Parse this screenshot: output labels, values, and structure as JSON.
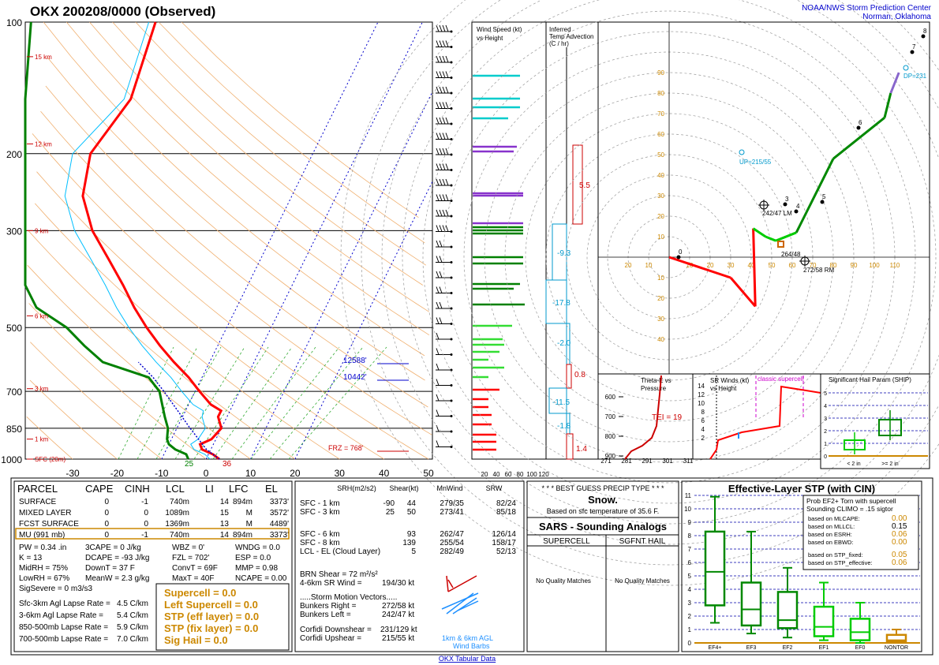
{
  "header": {
    "title": "OKX   200208/0000  (Observed)",
    "center_line1": "NOAA/NWS Storm Prediction Center",
    "center_line2": "Norman, Oklahoma",
    "footer_link": "OKX Tabular Data"
  },
  "colors": {
    "temp": "#ff0000",
    "dewpoint": "#008000",
    "wetbulb": "#00bfff",
    "parcel": "#0000cc",
    "blue_text": "#0000cc",
    "gold": "#cc8800",
    "axis": "#000000"
  },
  "chart_data": [
    {
      "type": "line",
      "name": "skewt",
      "ylabel_ticks": [
        "100",
        "200",
        "300",
        "500",
        "700",
        "850",
        "1000"
      ],
      "xticks": [
        "-30",
        "-20",
        "-10",
        "0",
        "10",
        "20",
        "30",
        "40",
        "50"
      ],
      "height_labels": [
        "15 km",
        "12 km",
        "9 km",
        "6 km",
        "3 km",
        "1 km",
        "SFC (20m)"
      ],
      "temperature_profile": [
        [
          1000,
          3
        ],
        [
          975,
          1
        ],
        [
          950,
          -2
        ],
        [
          925,
          -3
        ],
        [
          900,
          -1
        ],
        [
          850,
          0
        ],
        [
          800,
          -2
        ],
        [
          775,
          -2
        ],
        [
          750,
          -5
        ],
        [
          700,
          -9
        ],
        [
          650,
          -13
        ],
        [
          600,
          -18
        ],
        [
          550,
          -23
        ],
        [
          500,
          -28
        ],
        [
          450,
          -33
        ],
        [
          400,
          -38
        ],
        [
          350,
          -44
        ],
        [
          300,
          -51
        ],
        [
          250,
          -57
        ],
        [
          200,
          -60
        ],
        [
          150,
          -57
        ],
        [
          100,
          -60
        ]
      ],
      "dewpoint_profile": [
        [
          1000,
          -4
        ],
        [
          975,
          -5
        ],
        [
          950,
          -8
        ],
        [
          925,
          -10
        ],
        [
          900,
          -11
        ],
        [
          850,
          -12
        ],
        [
          800,
          -14
        ],
        [
          700,
          -18
        ],
        [
          650,
          -22
        ],
        [
          600,
          -34
        ],
        [
          550,
          -40
        ],
        [
          500,
          -46
        ],
        [
          450,
          -55
        ],
        [
          400,
          -68
        ],
        [
          350,
          -73
        ],
        [
          300,
          -74
        ],
        [
          250,
          -75
        ],
        [
          200,
          -78
        ],
        [
          150,
          -82
        ],
        [
          100,
          -88
        ]
      ],
      "annotations": {
        "lcl_height": "12588'",
        "el_height": "10442'",
        "frz": "FRZ = 768'",
        "sfc_temp": "36",
        "sfc_dew": "25"
      }
    },
    {
      "type": "bar",
      "name": "wind_speed_panel",
      "title": "Wind Speed (kt)",
      "subtitle": "vs Height",
      "xticks": [
        "20",
        "40",
        "60",
        "80",
        "100",
        "120"
      ]
    },
    {
      "type": "bar",
      "name": "inferred_temp_advection",
      "title": "Inferred",
      "subtitle": "Temp Advection",
      "subtitle2": "(C / hr)",
      "labels": [
        "5.5",
        "-9.3",
        "-17.8",
        "-2.0",
        "0.8",
        "-11.5",
        "-1.8",
        "1.4"
      ]
    },
    {
      "type": "line",
      "name": "hodograph",
      "xticks": [
        "20",
        "10",
        "10",
        "20",
        "30",
        "40",
        "50",
        "60",
        "70",
        "80",
        "90",
        "100",
        "110"
      ],
      "yticks": [
        "90",
        "80",
        "70",
        "60",
        "50",
        "40",
        "30",
        "20",
        "10",
        "10",
        "20",
        "30",
        "40"
      ],
      "labels": {
        "up": "UP=215/55",
        "dp": "DP=231",
        "lm": "242/47 LM",
        "rm": "272/58 RM",
        "mean": "264/48"
      },
      "points": [
        [
          0,
          0
        ],
        [
          30,
          -10
        ],
        [
          42,
          -24
        ],
        [
          41,
          14
        ],
        [
          47,
          10
        ],
        [
          52,
          8
        ],
        [
          62,
          12
        ],
        [
          80,
          48
        ],
        [
          105,
          68
        ],
        [
          108,
          80
        ],
        [
          112,
          90
        ]
      ]
    },
    {
      "type": "line",
      "name": "theta_e",
      "title": "Theta-E vs",
      "subtitle": "Pressure",
      "xticks": [
        "271",
        "281",
        "291",
        "301",
        "311"
      ],
      "yticks": [
        "600",
        "700",
        "800",
        "900"
      ],
      "tei": "TEI = 19"
    },
    {
      "type": "line",
      "name": "sr_winds",
      "title": "SR Winds (kt)",
      "subtitle": "vs Height",
      "yticks": [
        "14",
        "12",
        "10",
        "8",
        "6",
        "4",
        "2"
      ],
      "xticks": [
        "0",
        "40",
        "80",
        "120"
      ],
      "label": "classic supercell"
    },
    {
      "type": "bar",
      "name": "ship",
      "title": "Significant Hail Param (SHIP)",
      "yticks": [
        "5",
        "4",
        "3",
        "2",
        "1",
        "0"
      ],
      "categories": [
        "< 2 in",
        ">= 2 in"
      ]
    },
    {
      "type": "bar",
      "name": "effective_stp",
      "title": "Effective-Layer STP (with CIN)",
      "yticks": [
        "11",
        "10",
        "9",
        "8",
        "7",
        "6",
        "5",
        "4",
        "3",
        "2",
        "1",
        "0"
      ],
      "categories": [
        "EF4+",
        "EF3",
        "EF2",
        "EF1",
        "EF0",
        "NONTOR"
      ],
      "box": [
        {
          "low": 1.5,
          "q1": 2.8,
          "med": 5.3,
          "q3": 8.3,
          "high": 10.9
        },
        {
          "low": 0.7,
          "q1": 1.3,
          "med": 2.5,
          "q3": 4.5,
          "high": 8.3
        },
        {
          "low": 0.4,
          "q1": 1.1,
          "med": 1.7,
          "q3": 3.8,
          "high": 5.6
        },
        {
          "low": 0.2,
          "q1": 0.5,
          "med": 1.2,
          "q3": 2.7,
          "high": 4.5
        },
        {
          "low": 0.0,
          "q1": 0.2,
          "med": 0.8,
          "q3": 1.8,
          "high": 3.0
        },
        {
          "low": 0.0,
          "q1": 0.1,
          "med": 0.2,
          "q3": 0.6,
          "high": 1.0
        }
      ]
    }
  ],
  "parcel_table": {
    "headers": [
      "PARCEL",
      "CAPE",
      "CINH",
      "LCL",
      "LI",
      "LFC",
      "EL"
    ],
    "rows": [
      [
        "SURFACE",
        "0",
        "-1",
        "740m",
        "14",
        "894m",
        "3373'"
      ],
      [
        "MIXED LAYER",
        "0",
        "0",
        "1089m",
        "15",
        "M",
        "3572'"
      ],
      [
        "FCST SURFACE",
        "0",
        "0",
        "1369m",
        "13",
        "M",
        "4489'"
      ],
      [
        "MU   (991 mb)",
        "0",
        "-1",
        "740m",
        "14",
        "894m",
        "3373'"
      ]
    ]
  },
  "indices": [
    [
      "PW = 0.34 .in",
      "3CAPE = 0 J/kg",
      "WBZ = 0'",
      "WNDG = 0.0"
    ],
    [
      "K = 13",
      "DCAPE = -93 J/kg",
      "FZL = 702'",
      "ESP = 0.0"
    ],
    [
      "MidRH = 75%",
      "DownT = 37 F",
      "ConvT = 69F",
      "MMP = 0.98"
    ],
    [
      "LowRH = 67%",
      "MeanW = 2.3 g/kg",
      "MaxT = 40F",
      "NCAPE = 0.00"
    ]
  ],
  "sig_severe": "SigSevere = 0 m3/s3",
  "lapse_rates": [
    [
      "Sfc-3km Agl Lapse Rate =",
      "4.5 C/km"
    ],
    [
      "3-6km Agl Lapse Rate =",
      "5.4 C/km"
    ],
    [
      "850-500mb Lapse Rate =",
      "5.9 C/km"
    ],
    [
      "700-500mb Lapse Rate =",
      "7.0 C/km"
    ]
  ],
  "composite": [
    "Supercell = 0.0",
    "Left Supercell = 0.0",
    "STP (eff layer) = 0.0",
    "STP (fix layer) = 0.0",
    "Sig Hail = 0.0"
  ],
  "kinematics": {
    "headers": [
      "SRH(m2/s2)",
      "Shear(kt)",
      "MnWind",
      "SRW"
    ],
    "rows": [
      [
        "SFC - 1 km",
        "-90",
        "44",
        "279/35",
        "82/24"
      ],
      [
        "SFC - 3 km",
        "25",
        "50",
        "273/41",
        "85/18"
      ],
      [
        "SFC - 6 km",
        "",
        "93",
        "262/47",
        "126/14"
      ],
      [
        "SFC - 8 km",
        "",
        "139",
        "255/54",
        "158/17"
      ],
      [
        "LCL - EL (Cloud Layer)",
        "",
        "5",
        "282/49",
        "52/13"
      ]
    ],
    "brn_shear": "BRN Shear =   72 m²/s²",
    "sr_wind": "4-6km SR Wind =",
    "sr_wind_val": "194/30 kt",
    "storm_motion": ".....Storm Motion Vectors.....",
    "bunkers_right": "Bunkers Right =",
    "bunkers_right_val": "272/58 kt",
    "bunkers_left": "Bunkers Left =",
    "bunkers_left_val": "242/47 kt",
    "corfidi_down": "Corfidi Downshear =",
    "corfidi_down_val": "231/129 kt",
    "corfidi_up": "Corfidi Upshear =",
    "corfidi_up_val": "215/55 kt",
    "barb_label1": "1km & 6km AGL",
    "barb_label2": "Wind Barbs"
  },
  "precip": {
    "title": "* * * BEST GUESS PRECIP TYPE * * *",
    "type": "Snow.",
    "basis": "Based on sfc temperature of 35.6 F."
  },
  "sars": {
    "title": "SARS - Sounding Analogs",
    "col1": "SUPERCELL",
    "col2": "SGFNT HAIL",
    "col1_text": "No Quality Matches",
    "col2_text": "No Quality Matches"
  },
  "stp_box": {
    "line1": "Prob EF2+ Torn with supercell",
    "line2": "Sounding CLIMO = .15 sigtor",
    "items": [
      [
        "based on MLCAPE:",
        "0.00"
      ],
      [
        "based on MLLCL:",
        "0.15"
      ],
      [
        "based on ESRH:",
        "0.06"
      ],
      [
        "based on EBWD:",
        "0.00"
      ],
      [
        "based on STP_fixed:",
        "0.05"
      ],
      [
        "based on STP_effective:",
        "0.06"
      ]
    ]
  }
}
